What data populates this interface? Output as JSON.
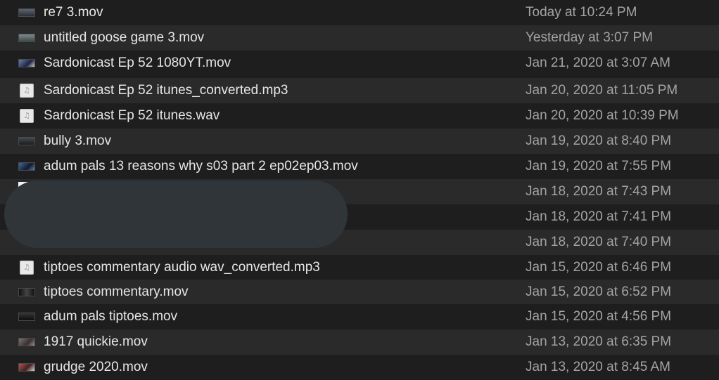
{
  "files": [
    {
      "name": "re7 3.mov",
      "date": "Today at 10:24 PM",
      "kind": "video",
      "icon": "video-thumbnail-icon"
    },
    {
      "name": "untitled goose game 3.mov",
      "date": "Yesterday at 3:07 PM",
      "kind": "video",
      "icon": "video-thumbnail-icon"
    },
    {
      "name": "Sardonicast Ep 52 1080YT.mov",
      "date": "Jan 21, 2020 at 3:07 AM",
      "kind": "video",
      "icon": "video-thumbnail-icon"
    },
    {
      "name": "Sardonicast Ep 52 itunes_converted.mp3",
      "date": "Jan 20, 2020 at 11:05 PM",
      "kind": "audio",
      "icon": "audio-file-icon"
    },
    {
      "name": "Sardonicast Ep 52 itunes.wav",
      "date": "Jan 20, 2020 at 10:39 PM",
      "kind": "audio",
      "icon": "audio-file-icon"
    },
    {
      "name": "bully 3.mov",
      "date": "Jan 19, 2020 at 8:40 PM",
      "kind": "video",
      "icon": "video-thumbnail-icon"
    },
    {
      "name": "adum pals 13 reasons why s03 part 2 ep02ep03.mov",
      "date": "Jan 19, 2020 at 7:55 PM",
      "kind": "video",
      "icon": "video-thumbnail-icon"
    },
    {
      "name": "",
      "date": "Jan 18, 2020 at 7:43 PM",
      "kind": "redacted",
      "icon": ""
    },
    {
      "name": "",
      "date": "Jan 18, 2020 at 7:41 PM",
      "kind": "redacted",
      "icon": ""
    },
    {
      "name": "",
      "date": "Jan 18, 2020 at 7:40 PM",
      "kind": "redacted",
      "icon": ""
    },
    {
      "name": "tiptoes commentary audio wav_converted.mp3",
      "date": "Jan 15, 2020 at 6:46 PM",
      "kind": "audio",
      "icon": "audio-file-icon"
    },
    {
      "name": "tiptoes commentary.mov",
      "date": "Jan 15, 2020 at 6:52 PM",
      "kind": "video",
      "icon": "video-thumbnail-icon"
    },
    {
      "name": "adum pals tiptoes.mov",
      "date": "Jan 15, 2020 at 4:56 PM",
      "kind": "video",
      "icon": "video-thumbnail-icon"
    },
    {
      "name": "1917 quickie.mov",
      "date": "Jan 13, 2020 at 6:35 PM",
      "kind": "video",
      "icon": "video-thumbnail-icon"
    },
    {
      "name": "grudge 2020.mov",
      "date": "Jan 13, 2020 at 8:45 AM",
      "kind": "video",
      "icon": "video-thumbnail-icon"
    }
  ],
  "audio_glyph": "♫"
}
